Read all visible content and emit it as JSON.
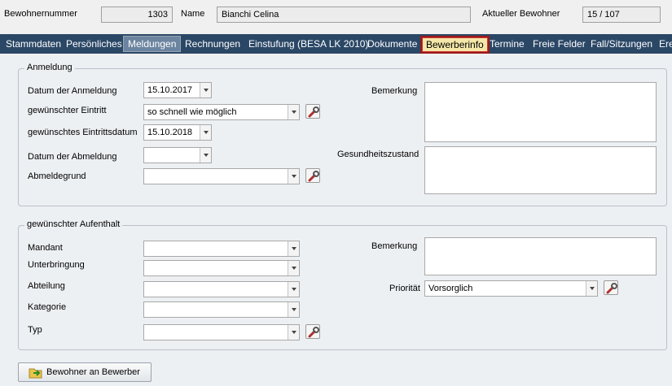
{
  "header": {
    "bewohnernummer_label": "Bewohnernummer",
    "bewohnernummer_value": "1303",
    "name_label": "Name",
    "name_value": "Bianchi Celina",
    "aktueller_label": "Aktueller Bewohner",
    "aktueller_value": "15 / 107"
  },
  "tabs": [
    {
      "label": "Stammdaten"
    },
    {
      "label": "Persönliches"
    },
    {
      "label": "Meldungen"
    },
    {
      "label": "Rechnungen"
    },
    {
      "label": "Einstufung (BESA LK 2010)"
    },
    {
      "label": "Dokumente"
    },
    {
      "label": "Bewerberinfo"
    },
    {
      "label": "Termine"
    },
    {
      "label": "Freie Felder"
    },
    {
      "label": "Fall/Sitzungen"
    },
    {
      "label": "Ere"
    }
  ],
  "anmeldung": {
    "title": "Anmeldung",
    "datum_anmeldung_label": "Datum der Anmeldung",
    "datum_anmeldung_value": "15.10.2017",
    "eintritt_label": "gewünschter Eintritt",
    "eintritt_value": "so schnell wie möglich",
    "eintrittsdatum_label": "gewünschtes Eintrittsdatum",
    "eintrittsdatum_value": "15.10.2018",
    "abmeldung_label": "Datum der Abmeldung",
    "abmeldung_value": "",
    "abmeldegrund_label": "Abmeldegrund",
    "abmeldegrund_value": "",
    "bemerkung_label": "Bemerkung",
    "gesundheit_label": "Gesundheitszustand"
  },
  "aufenthalt": {
    "title": "gewünschter Aufenthalt",
    "mandant_label": "Mandant",
    "unterbringung_label": "Unterbringung",
    "abteilung_label": "Abteilung",
    "kategorie_label": "Kategorie",
    "typ_label": "Typ",
    "bemerkung_label": "Bemerkung",
    "prioritaet_label": "Priorität",
    "prioritaet_value": "Vorsorglich"
  },
  "footer": {
    "button_label": "Bewohner an Bewerber"
  },
  "colors": {
    "tabbar": "#2b4766",
    "highlight_border": "#9a1a1a",
    "highlight_fill": "#f4e7a8"
  }
}
